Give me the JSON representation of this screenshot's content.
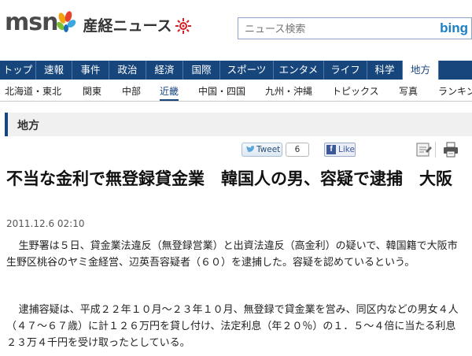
{
  "header": {
    "logo_text": "msn",
    "site_name": "産経ニュース",
    "search_placeholder": "ニュース検索",
    "search_brand": "bing"
  },
  "nav_primary": [
    {
      "label": "トップ"
    },
    {
      "label": "速報"
    },
    {
      "label": "事件"
    },
    {
      "label": "政治"
    },
    {
      "label": "経済"
    },
    {
      "label": "国際"
    },
    {
      "label": "スポーツ"
    },
    {
      "label": "エンタメ"
    },
    {
      "label": "ライフ"
    },
    {
      "label": "科学"
    },
    {
      "label": "地方"
    }
  ],
  "nav_secondary": [
    {
      "label": "北海道・東北"
    },
    {
      "label": "関東"
    },
    {
      "label": "中部"
    },
    {
      "label": "近畿"
    },
    {
      "label": "中国・四国"
    },
    {
      "label": "九州・沖縄"
    },
    {
      "label": "トピックス"
    },
    {
      "label": "写真"
    },
    {
      "label": "ランキング"
    }
  ],
  "section": {
    "title": "地方"
  },
  "share": {
    "tweet_label": "Tweet",
    "tweet_count": "6",
    "like_label": "Like"
  },
  "article": {
    "headline": "不当な金利で無登録貸金業　韓国人の男、容疑で逮捕　大阪",
    "date": "2011.12.6 02:10",
    "paragraphs": [
      "生野署は５日、貸金業法違反（無登録営業）と出資法違反（高金利）の疑いで、韓国籍で大阪市生野区桃谷のヤミ金経営、辺英吾容疑者（６０）を逮捕した。容疑を認めているという。",
      "逮捕容疑は、平成２２年１０月～２３年１０月、無登録で貸金業を営み、同区内などの男女４人（４７～６７歳）に計１２６万円を貸し付け、法定利息（年２０％）の１．５～４倍に当たる利息２３万４千円を受け取ったとしている。"
    ]
  },
  "colors": {
    "nav_bg": "#17467d",
    "accent": "#17467d"
  }
}
